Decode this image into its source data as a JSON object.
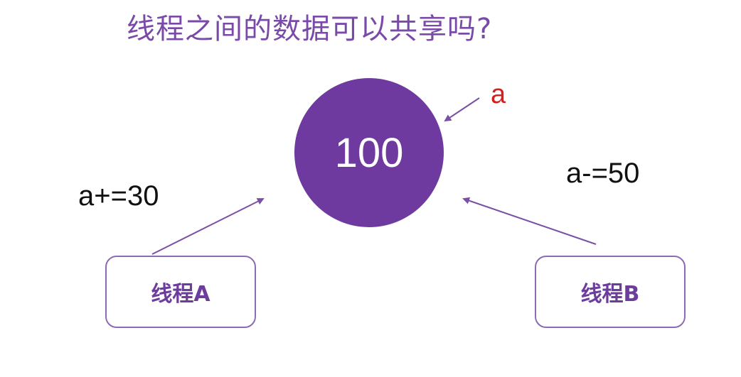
{
  "title": "线程之间的数据可以共享吗?",
  "shared_value": "100",
  "variable_label": "a",
  "thread_a": {
    "label": "线程A",
    "operation": "a+=30"
  },
  "thread_b": {
    "label": "线程B",
    "operation": "a-=50"
  },
  "colors": {
    "circle": "#6f3aa0",
    "title": "#7a4aa8",
    "variable_label": "#d51f1f",
    "arrow": "#7a4fa6"
  }
}
